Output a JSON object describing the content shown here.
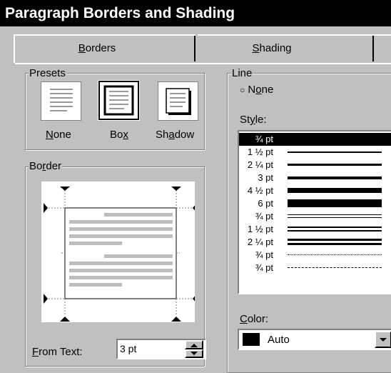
{
  "window": {
    "title": "Paragraph Borders and Shading"
  },
  "tabs": [
    {
      "label": "Borders",
      "accel": "B"
    },
    {
      "label": "Shading",
      "accel": "S"
    }
  ],
  "presets": {
    "group_label": "Presets",
    "items": [
      {
        "label": "None",
        "icon": "preset-none-icon"
      },
      {
        "label": "Box",
        "icon": "preset-box-icon"
      },
      {
        "label": "Shadow",
        "icon": "preset-shadow-icon"
      }
    ]
  },
  "border": {
    "group_label": "Border"
  },
  "from_text": {
    "label": "From Text:",
    "value": "3 pt"
  },
  "line": {
    "group_label": "Line",
    "none_label": "None",
    "style_label": "Style:",
    "styles": [
      "¾ pt",
      "1 ½ pt",
      "2 ¼ pt",
      "3 pt",
      "4 ½ pt",
      "6 pt",
      "¾ pt",
      "1 ½ pt",
      "2 ¼ pt",
      "¾ pt",
      "¾ pt"
    ],
    "selected_index": 0,
    "color_label": "Color:",
    "color_value": "Auto"
  },
  "colors": {
    "selection": "#000000",
    "face": "#c0c0c0",
    "preview_text": "#bdbdbd"
  }
}
